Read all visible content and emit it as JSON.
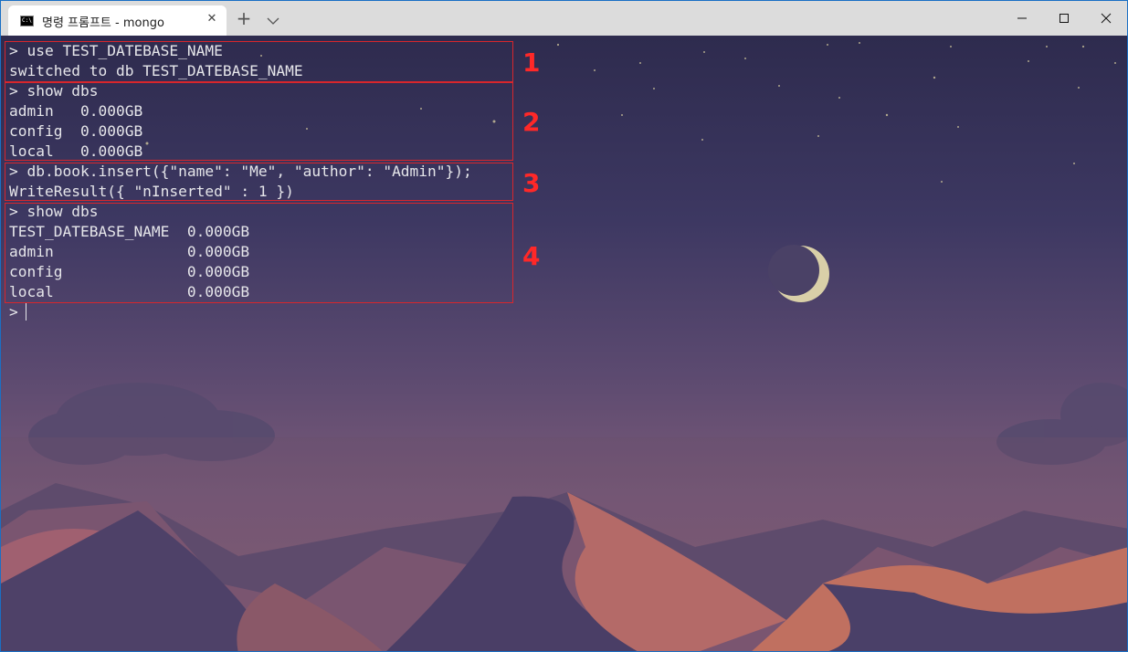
{
  "titlebar": {
    "tab_title": "명령 프롬프트 - mongo",
    "tab_icon_text": "C:\\",
    "tab_close": "✕",
    "newtab": "+",
    "dropdown_icon": "chevron-down-icon",
    "controls": [
      "minimize-icon",
      "maximize-icon",
      "close-icon"
    ]
  },
  "terminal": {
    "lines": [
      "> use TEST_DATEBASE_NAME",
      "switched to db TEST_DATEBASE_NAME",
      "> show dbs",
      "admin   0.000GB",
      "config  0.000GB",
      "local   0.000GB",
      "> db.book.insert({\"name\": \"Me\", \"author\": \"Admin\"});",
      "WriteResult({ \"nInserted\" : 1 })",
      "> show dbs",
      "TEST_DATEBASE_NAME  0.000GB",
      "admin               0.000GB",
      "config              0.000GB",
      "local               0.000GB"
    ],
    "prompt": ">"
  },
  "annotations": [
    {
      "label": "1"
    },
    {
      "label": "2"
    },
    {
      "label": "3"
    },
    {
      "label": "4"
    }
  ],
  "colors": {
    "annotation": "#ff2828",
    "text": "#e6e6ea",
    "titlebar": "#dcdcdc",
    "window_border": "#1a6fc4"
  }
}
